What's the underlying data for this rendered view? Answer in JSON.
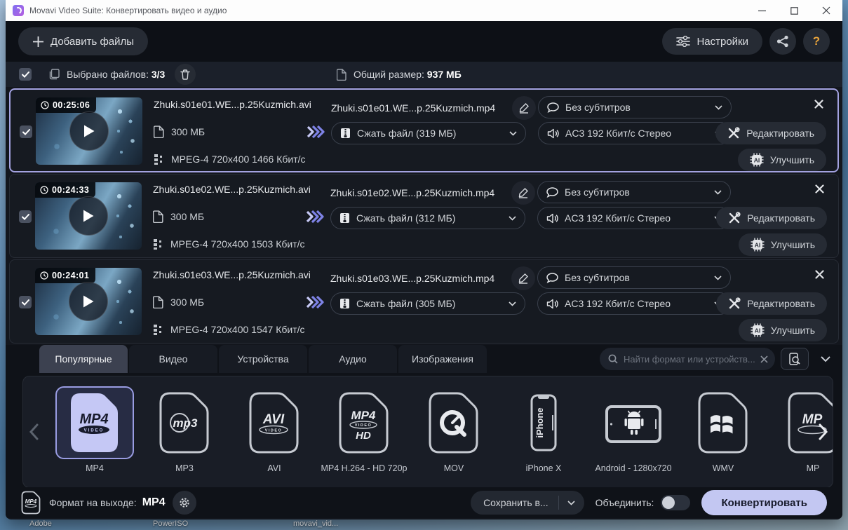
{
  "window": {
    "title": "Movavi Video Suite: Конвертировать видео и аудио"
  },
  "toolbar": {
    "add_files": "Добавить файлы",
    "settings": "Настройки"
  },
  "selection_bar": {
    "selected_label": "Выбрано файлов:",
    "selected_count": "3/3",
    "total_label": "Общий размер:",
    "total_size": "937 МБ"
  },
  "icons": {
    "ai_label": "AI"
  },
  "files": [
    {
      "duration": "00:25:06",
      "source_name": "Zhuki.s01e01.WE...p.25Kuzmich.avi",
      "size": "300 МБ",
      "codec": "MPEG-4 720x400 1466 Кбит/с",
      "output_name": "Zhuki.s01e01.WE...p.25Kuzmich.mp4",
      "compress": "Сжать файл (319 МБ)",
      "subtitles": "Без субтитров",
      "audio": "AC3 192 Кбит/с Стерео",
      "edit_label": "Редактировать",
      "enhance_label": "Улучшить"
    },
    {
      "duration": "00:24:33",
      "source_name": "Zhuki.s01e02.WE...p.25Kuzmich.avi",
      "size": "300 МБ",
      "codec": "MPEG-4 720x400 1503 Кбит/с",
      "output_name": "Zhuki.s01e02.WE...p.25Kuzmich.mp4",
      "compress": "Сжать файл (312 МБ)",
      "subtitles": "Без субтитров",
      "audio": "AC3 192 Кбит/с Стерео",
      "edit_label": "Редактировать",
      "enhance_label": "Улучшить"
    },
    {
      "duration": "00:24:01",
      "source_name": "Zhuki.s01e03.WE...p.25Kuzmich.avi",
      "size": "300 МБ",
      "codec": "MPEG-4 720x400 1547 Кбит/с",
      "output_name": "Zhuki.s01e03.WE...p.25Kuzmich.mp4",
      "compress": "Сжать файл (305 МБ)",
      "subtitles": "Без субтитров",
      "audio": "AC3 192 Кбит/с Стерео",
      "edit_label": "Редактировать",
      "enhance_label": "Улучшить"
    }
  ],
  "format_tabs": [
    "Популярные",
    "Видео",
    "Устройства",
    "Аудио",
    "Изображения"
  ],
  "search": {
    "placeholder": "Найти формат или устройств..."
  },
  "formats": [
    {
      "label": "MP4",
      "icon_text": "MP4",
      "badge": "VIDEO"
    },
    {
      "label": "MP3",
      "icon_text": "mp3"
    },
    {
      "label": "AVI",
      "icon_text": "AVI",
      "badge": "VIDEO"
    },
    {
      "label": "MP4 H.264 - HD 720p",
      "icon_text": "MP4",
      "badge": "VIDEO",
      "sub": "HD"
    },
    {
      "label": "MOV"
    },
    {
      "label": "iPhone X",
      "icon_text": "iPhone"
    },
    {
      "label": "Android - 1280x720"
    },
    {
      "label": "WMV"
    },
    {
      "label": "MP",
      "icon_text": "MP"
    }
  ],
  "footer": {
    "mini_icon_text": "MP4",
    "output_format_label": "Формат на выходе:",
    "output_format": "MP4",
    "save_to": "Сохранить в...",
    "merge_label": "Объединить:",
    "convert": "Конвертировать"
  },
  "desktop": {
    "labels": [
      "Adobe",
      "PowerISO",
      "movavi_vid..."
    ]
  },
  "colors": {
    "accent": "#c3c7f2",
    "selected_border": "#a3a2e0",
    "help": "#e8a33b"
  }
}
